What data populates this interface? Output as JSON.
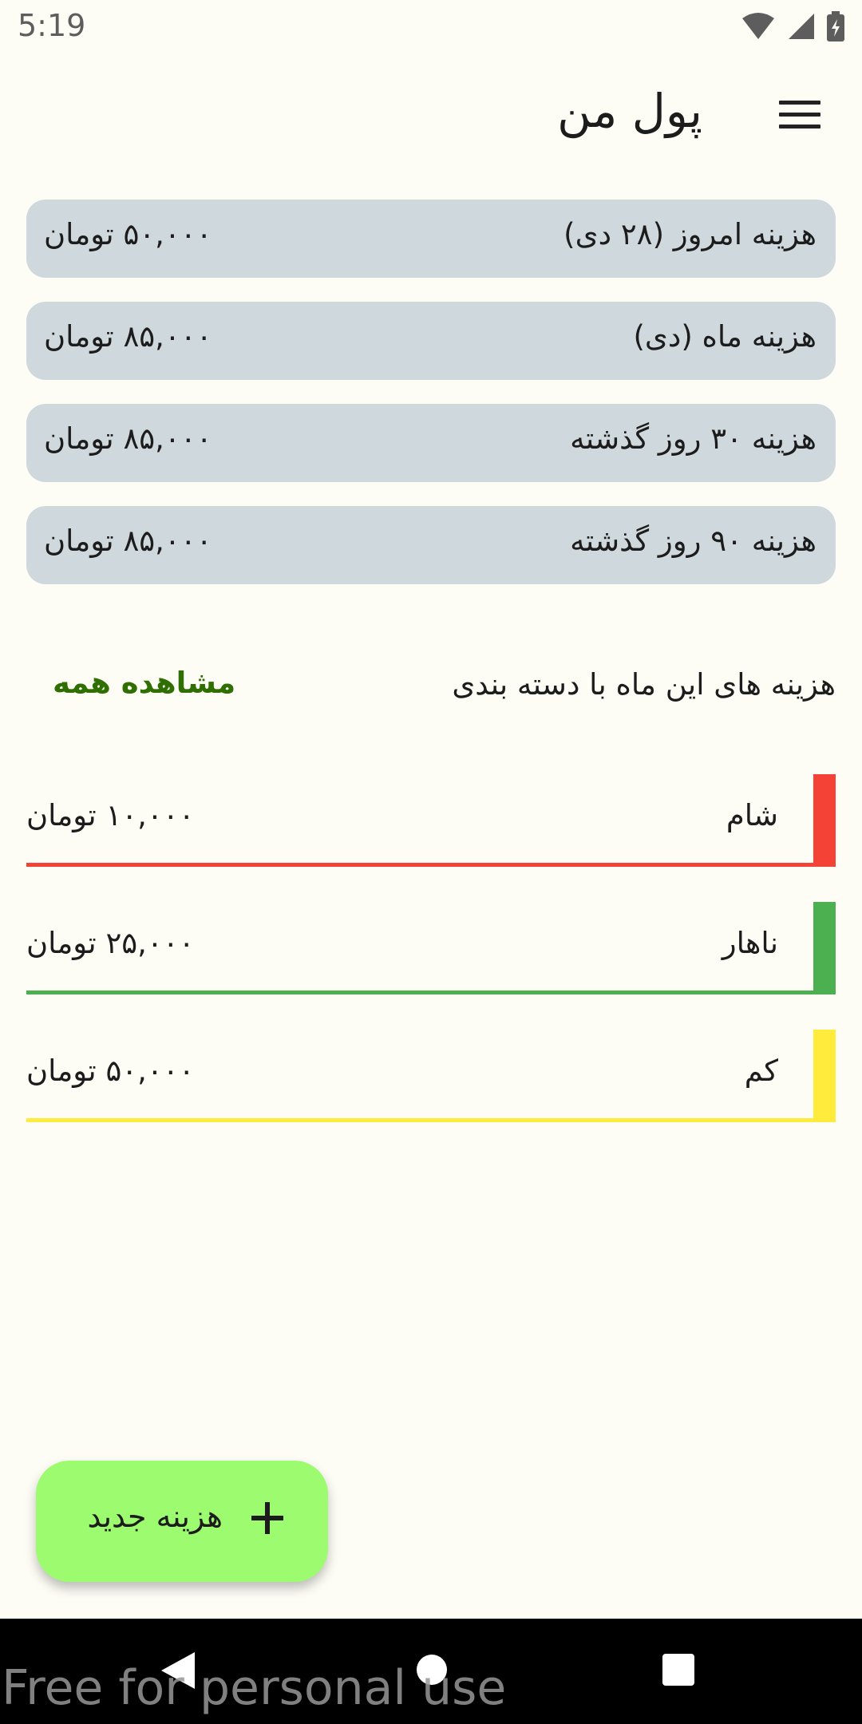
{
  "status_bar": {
    "time": "5:19",
    "icons": [
      "wifi-icon",
      "signal-icon",
      "battery-charging-icon"
    ]
  },
  "app_bar": {
    "title": "پول من",
    "menu_icon": "menu-icon"
  },
  "summary": [
    {
      "label": "هزینه امروز (۲۸ دی)",
      "value": "۵۰,۰۰۰ تومان"
    },
    {
      "label": "هزینه ماه (دی)",
      "value": "۸۵,۰۰۰ تومان"
    },
    {
      "label": "هزینه ۳۰ روز گذشته",
      "value": "۸۵,۰۰۰ تومان"
    },
    {
      "label": "هزینه ۹۰ روز گذشته",
      "value": "۸۵,۰۰۰ تومان"
    }
  ],
  "categories_section": {
    "title": "هزینه های این ماه با دسته بندی",
    "view_all": "مشاهده همه"
  },
  "categories": [
    {
      "name": "شام",
      "amount": "۱۰,۰۰۰ تومان",
      "color": "#f44336"
    },
    {
      "name": "ناهار",
      "amount": "۲۵,۰۰۰ تومان",
      "color": "#4caf50"
    },
    {
      "name": "کم",
      "amount": "۵۰,۰۰۰ تومان",
      "color": "#ffeb3b"
    }
  ],
  "fab": {
    "label": "هزینه جدید",
    "icon": "plus-icon"
  },
  "nav_bar": {
    "icons": [
      "back-icon",
      "home-icon",
      "recents-icon"
    ]
  },
  "watermark": "Free for personal use"
}
